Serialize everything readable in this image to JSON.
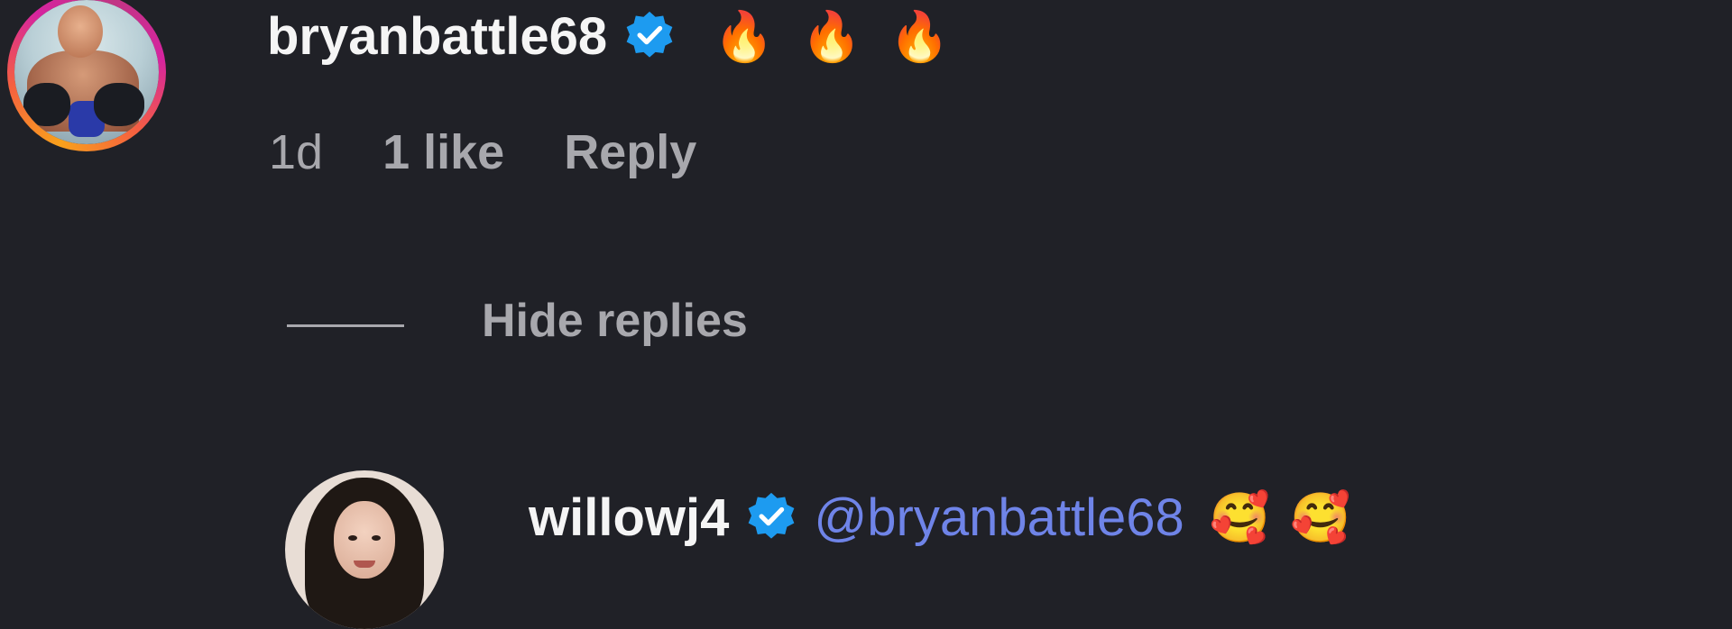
{
  "comment": {
    "username": "bryanbattle68",
    "verified": true,
    "text_emojis": [
      "🔥",
      "🔥",
      "🔥"
    ],
    "age": "1d",
    "likes": "1 like",
    "reply_label": "Reply"
  },
  "thread": {
    "hide_replies_label": "Hide replies"
  },
  "reply": {
    "username": "willowj4",
    "verified": true,
    "mention": "@bryanbattle68",
    "text_emojis": [
      "🥰",
      "🥰"
    ]
  },
  "colors": {
    "background": "#202127",
    "verified_badge": "#1d9bf0",
    "mention": "#6f84e8",
    "muted_text": "#a8a8ad"
  },
  "icons": {
    "verified": "verified-badge-icon",
    "story_ring": "story-ring"
  }
}
